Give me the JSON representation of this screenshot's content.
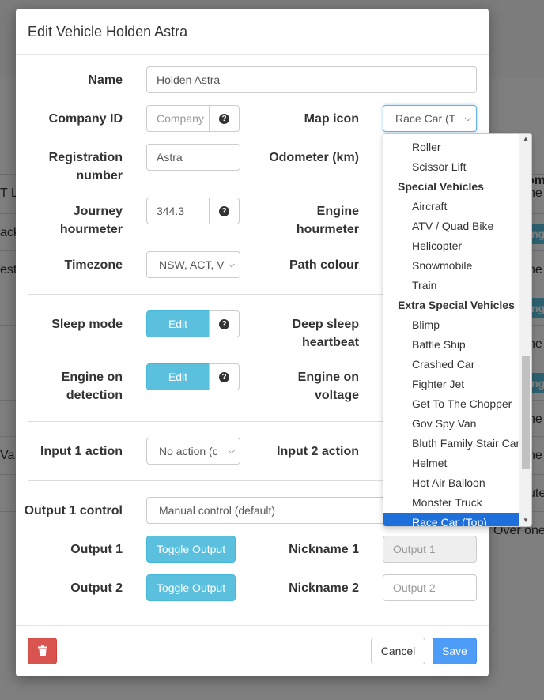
{
  "background": {
    "rows": [
      {
        "left": "T LE",
        "right": "ne"
      },
      {
        "left": "ack",
        "badge": "ng"
      },
      {
        "left": "est",
        "right": "ne"
      },
      {
        "badge": "ng"
      },
      {
        "right": "ne"
      },
      {
        "badge": "ng"
      },
      {
        "right": "ne"
      },
      {
        "left": "Va",
        "right": "ne"
      },
      {
        "right": "ute"
      },
      {
        "right": "Over one"
      }
    ],
    "header_fragment": "om"
  },
  "modal": {
    "title": "Edit Vehicle Holden Astra",
    "fields": {
      "name": {
        "label": "Name",
        "value": "Holden Astra"
      },
      "company_id": {
        "label": "Company ID",
        "placeholder": "Company"
      },
      "map_icon": {
        "label": "Map icon",
        "value": "Race Car (T"
      },
      "registration": {
        "label_line1": "Registration",
        "label_line2": "number",
        "value": "Astra"
      },
      "odometer": {
        "label": "Odometer (km)"
      },
      "journey_hourmeter": {
        "label_line1": "Journey",
        "label_line2": "hourmeter",
        "value": "344.3"
      },
      "engine_hourmeter": {
        "label_line1": "Engine",
        "label_line2": "hourmeter"
      },
      "timezone": {
        "label": "Timezone",
        "value": "NSW, ACT, V"
      },
      "path_colour": {
        "label": "Path colour"
      },
      "sleep_mode": {
        "label": "Sleep mode",
        "button": "Edit"
      },
      "deep_sleep": {
        "label_line1": "Deep sleep",
        "label_line2": "heartbeat"
      },
      "engine_on_detection": {
        "label_line1": "Engine on",
        "label_line2": "detection",
        "button": "Edit"
      },
      "engine_on_voltage": {
        "label_line1": "Engine on",
        "label_line2": "voltage"
      },
      "input1": {
        "label": "Input 1 action",
        "value": "No action (c"
      },
      "input2": {
        "label": "Input 2 action"
      },
      "output1_control": {
        "label": "Output 1 control",
        "value": "Manual control (default)"
      },
      "output1": {
        "label": "Output 1",
        "button": "Toggle Output"
      },
      "nickname1": {
        "label": "Nickname 1",
        "placeholder": "Output 1"
      },
      "output2": {
        "label": "Output 2",
        "button": "Toggle Output"
      },
      "nickname2": {
        "label": "Nickname 2",
        "placeholder": "Output 2"
      }
    },
    "footer": {
      "cancel": "Cancel",
      "save": "Save"
    }
  },
  "dropdown": {
    "items": [
      {
        "type": "option",
        "text": "Roller"
      },
      {
        "type": "option",
        "text": "Scissor Lift"
      },
      {
        "type": "group",
        "text": "Special Vehicles"
      },
      {
        "type": "option",
        "text": "Aircraft"
      },
      {
        "type": "option",
        "text": "ATV / Quad Bike"
      },
      {
        "type": "option",
        "text": "Helicopter"
      },
      {
        "type": "option",
        "text": "Snowmobile"
      },
      {
        "type": "option",
        "text": "Train"
      },
      {
        "type": "group",
        "text": "Extra Special Vehicles"
      },
      {
        "type": "option",
        "text": "Blimp"
      },
      {
        "type": "option",
        "text": "Battle Ship"
      },
      {
        "type": "option",
        "text": "Crashed Car"
      },
      {
        "type": "option",
        "text": "Fighter Jet"
      },
      {
        "type": "option",
        "text": "Get To The Chopper"
      },
      {
        "type": "option",
        "text": "Gov Spy Van"
      },
      {
        "type": "option",
        "text": "Bluth Family Stair Car"
      },
      {
        "type": "option",
        "text": "Helmet"
      },
      {
        "type": "option",
        "text": "Hot Air Balloon"
      },
      {
        "type": "option",
        "text": "Monster Truck"
      },
      {
        "type": "option",
        "text": "Race Car (Top)",
        "selected": true
      }
    ]
  },
  "colors": {
    "info": "#5bc0de",
    "primary": "#4d9cf8",
    "danger": "#d9534f",
    "selected": "#1e6fd9"
  },
  "icons": {
    "help": "question-circle-icon",
    "delete": "trash-icon",
    "select": "chevron-down-icon"
  }
}
